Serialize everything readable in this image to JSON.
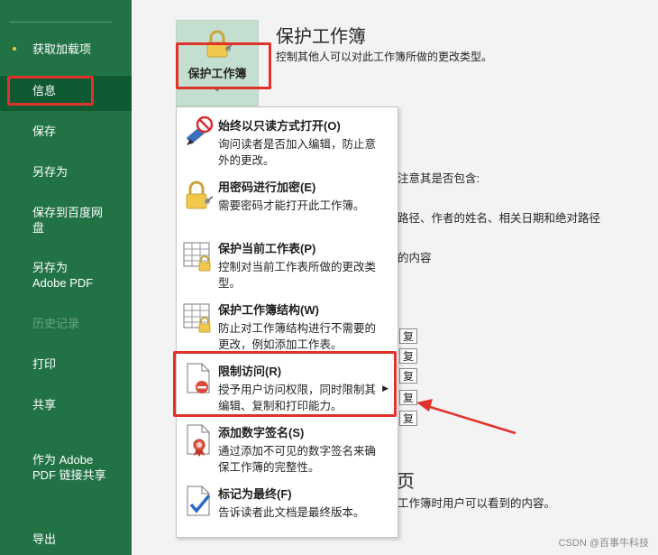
{
  "sidebar": {
    "items": [
      {
        "label": "获取加载项",
        "state": "dot"
      },
      {
        "label": "信息",
        "state": "active"
      },
      {
        "label": "保存",
        "state": "normal"
      },
      {
        "label": "另存为",
        "state": "normal"
      },
      {
        "label": "保存到百度网盘",
        "line1": "保存到百度网",
        "line2": "盘",
        "state": "normal"
      },
      {
        "label": "另存为 Adobe PDF",
        "line1": "另存为",
        "line2": "Adobe PDF",
        "state": "normal"
      },
      {
        "label": "历史记录",
        "state": "disabled"
      },
      {
        "label": "打印",
        "state": "normal"
      },
      {
        "label": "共享",
        "state": "normal"
      },
      {
        "label": "作为 Adobe PDF 链接共享",
        "line1": "作为 Adobe",
        "line2": "PDF 链接共享",
        "state": "normal"
      },
      {
        "label": "导出",
        "state": "normal"
      }
    ]
  },
  "protect": {
    "button_label": "保护工作簿",
    "button_arrow": "⌄",
    "title": "保护工作簿",
    "description": "控制其他人可以对此工作簿所做的更改类型。"
  },
  "background": {
    "text1": "注意其是否包含:",
    "text2": "路径、作者的姓名、相关日期和绝对路径",
    "text3": "的内容",
    "fu": "复",
    "heading_partial": "页",
    "text4": "工作簿时用户可以看到的内容。"
  },
  "menu": {
    "items": [
      {
        "title": "始终以只读方式打开(O)",
        "desc": "询问读者是否加入编辑，防止意外的更改。",
        "icon": "pencil-no-icon"
      },
      {
        "title": "用密码进行加密(E)",
        "desc": "需要密码才能打开此工作簿。",
        "icon": "lock-key-icon"
      },
      {
        "title": "保护当前工作表(P)",
        "desc": "控制对当前工作表所做的更改类型。",
        "icon": "sheet-lock-icon"
      },
      {
        "title": "保护工作簿结构(W)",
        "desc": "防止对工作簿结构进行不需要的更改，例如添加工作表。",
        "icon": "workbook-lock-icon"
      },
      {
        "title": "限制访问(R)",
        "desc": "授予用户访问权限，同时限制其编辑、复制和打印能力。",
        "icon": "restrict-access-icon",
        "submenu": "▶"
      },
      {
        "title": "添加数字签名(S)",
        "desc": "通过添加不可见的数字签名来确保工作簿的完整性。",
        "icon": "signature-ribbon-icon"
      },
      {
        "title": "标记为最终(F)",
        "desc": "告诉读者此文档是最终版本。",
        "icon": "mark-final-icon"
      }
    ]
  },
  "watermark": "CSDN @百事牛科技",
  "colors": {
    "sidebar": "#217346",
    "highlight": "#e0322b",
    "button": "#c4dfcf"
  }
}
